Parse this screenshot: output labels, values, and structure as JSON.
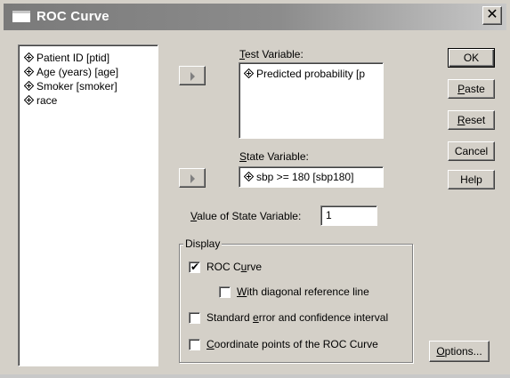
{
  "window": {
    "title": "ROC Curve",
    "close_glyph": "✕"
  },
  "variables_list": [
    {
      "label": "Patient ID [ptid]",
      "icon": "scale-variable-icon"
    },
    {
      "label": "Age (years) [age]",
      "icon": "scale-variable-icon"
    },
    {
      "label": "Smoker [smoker]",
      "icon": "scale-variable-icon"
    },
    {
      "label": "race",
      "icon": "scale-variable-icon"
    }
  ],
  "test_variable": {
    "label_key": "T",
    "label_rest": "est Variable:",
    "value": "Predicted probability [p"
  },
  "state_variable": {
    "label_key": "S",
    "label_rest": "tate Variable:",
    "value": "sbp >= 180 [sbp180]"
  },
  "state_value": {
    "label_key": "V",
    "label_rest": "alue of State Variable:",
    "value": "1"
  },
  "buttons": {
    "ok": "OK",
    "paste_key": "P",
    "paste_rest": "aste",
    "reset_key": "R",
    "reset_rest": "eset",
    "cancel": "Cancel",
    "help": "Help",
    "options_key": "O",
    "options_rest": "ptions..."
  },
  "display": {
    "title": "Display",
    "roc_curve": {
      "pre": "ROC C",
      "key": "u",
      "post": "rve",
      "checked": true
    },
    "diagonal": {
      "pre": "",
      "key": "W",
      "post": "ith diagonal reference line",
      "checked": false
    },
    "std_error": {
      "pre": "Standard ",
      "key": "e",
      "post": "rror and confidence interval",
      "checked": false
    },
    "coords": {
      "pre": "",
      "key": "C",
      "post": "oordinate points of the ROC Curve",
      "checked": false
    }
  },
  "colors": {
    "face": "#d4d0c8",
    "titlebar": "#8c8c8c",
    "field": "#ffffff"
  }
}
